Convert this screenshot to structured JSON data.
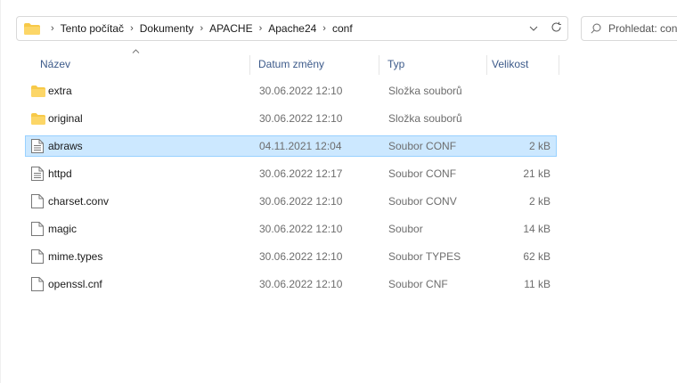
{
  "address_bar": {
    "breadcrumbs": [
      "Tento počítač",
      "Dokumenty",
      "APACHE",
      "Apache24",
      "conf"
    ],
    "dropdown_icon": "chevron-down-icon",
    "refresh_icon": "refresh-icon"
  },
  "search": {
    "placeholder": "Prohledat: conf"
  },
  "columns": {
    "name": "Název",
    "date": "Datum změny",
    "type": "Typ",
    "size": "Velikost",
    "sort_column": "name"
  },
  "files": [
    {
      "name": "extra",
      "date": "30.06.2022 12:10",
      "type": "Složka souborů",
      "size": "",
      "icon": "folder-icon",
      "selected": false
    },
    {
      "name": "original",
      "date": "30.06.2022 12:10",
      "type": "Složka souborů",
      "size": "",
      "icon": "folder-icon",
      "selected": false
    },
    {
      "name": "abraws",
      "date": "04.11.2021 12:04",
      "type": "Soubor CONF",
      "size": "2 kB",
      "icon": "text-file-icon",
      "selected": true
    },
    {
      "name": "httpd",
      "date": "30.06.2022 12:17",
      "type": "Soubor CONF",
      "size": "21 kB",
      "icon": "text-file-icon",
      "selected": false
    },
    {
      "name": "charset.conv",
      "date": "30.06.2022 12:10",
      "type": "Soubor CONV",
      "size": "2 kB",
      "icon": "blank-file-icon",
      "selected": false
    },
    {
      "name": "magic",
      "date": "30.06.2022 12:10",
      "type": "Soubor",
      "size": "14 kB",
      "icon": "blank-file-icon",
      "selected": false
    },
    {
      "name": "mime.types",
      "date": "30.06.2022 12:10",
      "type": "Soubor TYPES",
      "size": "62 kB",
      "icon": "blank-file-icon",
      "selected": false
    },
    {
      "name": "openssl.cnf",
      "date": "30.06.2022 12:10",
      "type": "Soubor CNF",
      "size": "11 kB",
      "icon": "blank-file-icon",
      "selected": false
    }
  ],
  "colors": {
    "folder": "#f7c948",
    "selection_bg": "#cce8ff",
    "selection_border": "#99d1ff",
    "header_text": "#3c5a8a"
  }
}
